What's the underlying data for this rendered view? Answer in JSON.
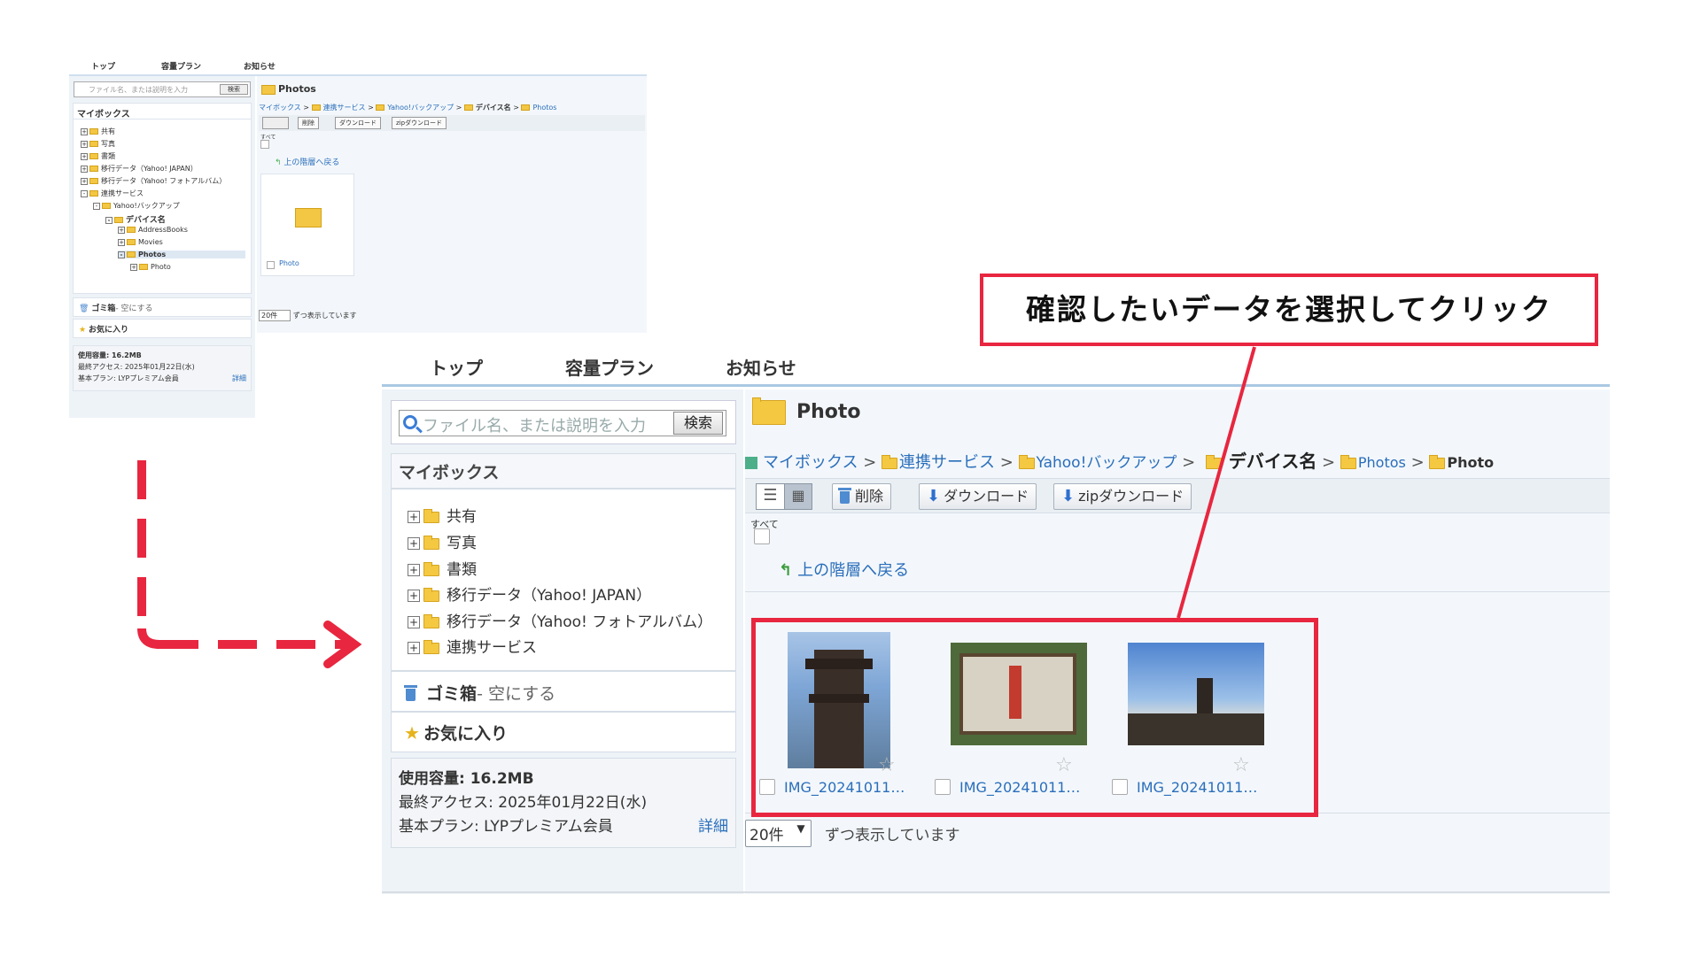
{
  "colors": {
    "accent_red": "#e8263f",
    "link_blue": "#2a6ebb",
    "folder_yellow": "#f5c842",
    "bg_panel": "#eef3f8"
  },
  "callout": {
    "text": "確認したいデータを選択してクリック"
  },
  "small": {
    "nav": [
      "トップ",
      "容量プラン",
      "お知らせ"
    ],
    "search": {
      "placeholder": "ファイル名、または説明を入力",
      "button": "検索"
    },
    "mybox_title": "マイボックス",
    "tree": [
      "共有",
      "写真",
      "書類",
      "移行データ（Yahoo! JAPAN）",
      "移行データ（Yahoo! フォトアルバム）",
      "連携サービス",
      "Yahoo!バックアップ",
      "デバイス名",
      "AddressBooks",
      "Movies",
      "Photos",
      "Photo"
    ],
    "trash": "ゴミ箱",
    "trash_empty": "- 空にする",
    "favorites": "お気に入り",
    "usage": "使用容量: 16.2MB",
    "last_access": "最終アクセス: 2025年01月22日(水)",
    "plan": "基本プラン: LYPプレミアム会員",
    "details": "詳細",
    "folder_title": "Photos",
    "breadcrumb": [
      "マイボックス",
      "連携サービス",
      "Yahoo!バックアップ",
      "デバイス名",
      "Photos"
    ],
    "toolbar": {
      "delete": "削除",
      "download": "ダウンロード",
      "zip": "zipダウンロード"
    },
    "select_all": "すべて",
    "up": "上の階層へ戻る",
    "item_name": "Photo",
    "per_page": "20件",
    "per_page_suffix": "ずつ表示しています"
  },
  "large": {
    "nav": [
      "トップ",
      "容量プラン",
      "お知らせ"
    ],
    "search": {
      "placeholder": "ファイル名、または説明を入力",
      "button": "検索"
    },
    "mybox_title": "マイボックス",
    "tree": [
      "共有",
      "写真",
      "書類",
      "移行データ（Yahoo! JAPAN）",
      "移行データ（Yahoo! フォトアルバム）",
      "連携サービス"
    ],
    "trash": "ゴミ箱",
    "trash_empty": "- 空にする",
    "favorites": "お気に入り",
    "usage": "使用容量: 16.2MB",
    "last_access": "最終アクセス: 2025年01月22日(水)",
    "plan": "基本プラン: LYPプレミアム会員",
    "details": "詳細",
    "folder_title": "Photo",
    "breadcrumb": [
      "マイボックス",
      "連携サービス",
      "Yahoo!バックアップ",
      "デバイス名",
      "Photos",
      "Photo"
    ],
    "toolbar": {
      "delete": "削除",
      "download": "ダウンロード",
      "zip": "zipダウンロード"
    },
    "select_all": "すべて",
    "up": "上の階層へ戻る",
    "files": [
      "IMG_20241011…",
      "IMG_20241011…",
      "IMG_20241011…"
    ],
    "per_page": "20件",
    "per_page_suffix": "ずつ表示しています"
  }
}
